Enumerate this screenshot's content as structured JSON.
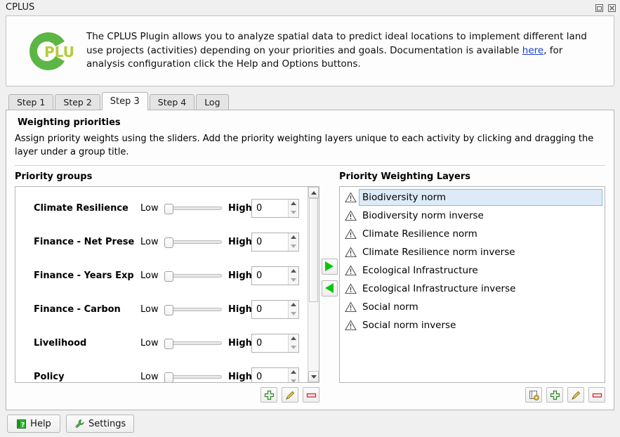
{
  "window": {
    "title": "CPLUS",
    "controls": [
      {
        "name": "restore-window-button",
        "icon": "restore-icon"
      },
      {
        "name": "close-window-button",
        "icon": "close-icon"
      }
    ]
  },
  "banner": {
    "logo_alt": "cplus-logo",
    "logo_text": "PLUS",
    "text_part1": "The CPLUS Plugin allows you to analyze spatial data to predict ideal locations to implement different land use projects (activities) depending on your priorities and goals. Documentation is available ",
    "link_text": "here",
    "text_part2": ", for analysis configuration click the Help and Options buttons."
  },
  "tabs": [
    {
      "label": "Step 1",
      "active": false
    },
    {
      "label": "Step 2",
      "active": false
    },
    {
      "label": "Step 3",
      "active": true
    },
    {
      "label": "Step 4",
      "active": false
    },
    {
      "label": "Log",
      "active": false
    }
  ],
  "panel": {
    "heading": "Weighting priorities",
    "description": "Assign priority weights using the sliders. Add the priority weighting layers unique to each activity by clicking and dragging the layer under a group title."
  },
  "priority_groups": {
    "title": "Priority groups",
    "low_label": "Low",
    "high_label": "High",
    "rows": [
      {
        "name": "Climate Resilience",
        "value": "0",
        "slider_pos": 0
      },
      {
        "name": "Finance - Net Prese",
        "value": "0",
        "slider_pos": 0
      },
      {
        "name": "Finance - Years Exp",
        "value": "0",
        "slider_pos": 0
      },
      {
        "name": "Finance - Carbon",
        "value": "0",
        "slider_pos": 0
      },
      {
        "name": "Livelihood",
        "value": "0",
        "slider_pos": 0
      },
      {
        "name": "Policy",
        "value": "0",
        "slider_pos": 0
      }
    ],
    "scroll_thumb_percent": 60,
    "tools": [
      {
        "name": "add-priority-group-button",
        "icon": "plus-icon"
      },
      {
        "name": "edit-priority-group-button",
        "icon": "pencil-icon"
      },
      {
        "name": "remove-priority-group-button",
        "icon": "minus-icon"
      }
    ]
  },
  "transfer_buttons": [
    {
      "name": "move-layer-right-button",
      "icon": "play-right-icon"
    },
    {
      "name": "move-layer-left-button",
      "icon": "play-left-icon"
    }
  ],
  "priority_layers": {
    "title": "Priority Weighting Layers",
    "items": [
      {
        "label": "Biodiversity norm",
        "selected": true
      },
      {
        "label": "Biodiversity norm inverse",
        "selected": false
      },
      {
        "label": "Climate Resilience norm",
        "selected": false
      },
      {
        "label": "Climate Resilience norm inverse",
        "selected": false
      },
      {
        "label": "Ecological Infrastructure",
        "selected": false
      },
      {
        "label": "Ecological Infrastructure inverse",
        "selected": false
      },
      {
        "label": "Social norm",
        "selected": false
      },
      {
        "label": "Social norm inverse",
        "selected": false
      }
    ],
    "tools": [
      {
        "name": "add-layer-from-source-button",
        "icon": "layer-settings-icon"
      },
      {
        "name": "add-priority-layer-button",
        "icon": "plus-icon"
      },
      {
        "name": "edit-priority-layer-button",
        "icon": "pencil-icon"
      },
      {
        "name": "remove-priority-layer-button",
        "icon": "minus-icon"
      }
    ]
  },
  "footer": {
    "help_label": "Help",
    "settings_label": "Settings"
  },
  "colors": {
    "accent_green": "#5cb646",
    "logo_lime": "#b5cc3a",
    "arrow_green": "#0ac60a",
    "selection_bg": "#dcebf7",
    "selection_border": "#8fb8d8",
    "link": "#1a3fcf",
    "window_bg": "#f0f0f0",
    "panel_bg": "#fdfdfd"
  }
}
